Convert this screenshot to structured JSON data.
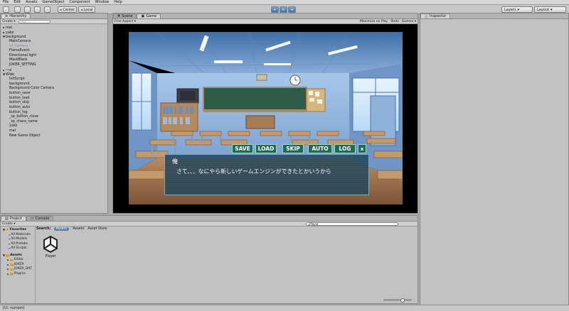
{
  "menu": [
    "File",
    "Edit",
    "Assets",
    "GameObject",
    "Component",
    "Window",
    "Help"
  ],
  "toolbar": {
    "pivot_label": "Center",
    "space_label": "Local",
    "layers_label": "Layers",
    "layout_label": "Layout"
  },
  "hierarchy": {
    "tab": "Hierarchy",
    "create_label": "Create",
    "search_placeholder": "All",
    "items": [
      {
        "label": "mai",
        "arrow": "►",
        "level": 0
      },
      {
        "label": "yako",
        "arrow": "►",
        "level": 0
      },
      {
        "label": "background",
        "arrow": "▼",
        "level": 0
      },
      {
        "label": "MainCamera",
        "arrow": "",
        "level": 1
      },
      {
        "label": "UI_Camera",
        "arrow": "",
        "level": 1
      },
      {
        "label": "FlameEvent",
        "arrow": "",
        "level": 1
      },
      {
        "label": "Directional light",
        "arrow": "",
        "level": 1
      },
      {
        "label": "MaskBlack",
        "arrow": "",
        "level": 1
      },
      {
        "label": "JOKER_SETTING",
        "arrow": "",
        "level": 1
      },
      {
        "label": "~ui",
        "arrow": "►",
        "level": 0
      },
      {
        "label": "Wide",
        "arrow": "▼",
        "level": 0
      },
      {
        "label": "InitScript",
        "arrow": "",
        "level": 1
      },
      {
        "label": "background",
        "arrow": "",
        "level": 1
      },
      {
        "label": "Background Color Camera",
        "arrow": "",
        "level": 1
      },
      {
        "label": "button_save",
        "arrow": "",
        "level": 1
      },
      {
        "label": "button_load",
        "arrow": "",
        "level": 1
      },
      {
        "label": "button_skip",
        "arrow": "",
        "level": 1
      },
      {
        "label": "button_auto",
        "arrow": "",
        "level": 1
      },
      {
        "label": "button_log",
        "arrow": "",
        "level": 1
      },
      {
        "label": "_sp_button_close",
        "arrow": "",
        "level": 1
      },
      {
        "label": "_sp_chara_name",
        "arrow": "",
        "level": 1
      },
      {
        "label": "yako",
        "arrow": "",
        "level": 1
      },
      {
        "label": "mai",
        "arrow": "",
        "level": 1
      },
      {
        "label": "New Game Object",
        "arrow": "",
        "level": 1
      }
    ]
  },
  "tabs": {
    "scene": "Scene",
    "game": "Game",
    "inspector": "Inspector",
    "project": "Project",
    "console": "Console"
  },
  "game": {
    "aspect_label": "Free Aspect",
    "maximize_label": "Maximize on Play",
    "stats_label": "Stats",
    "gizmos_label": "Gizmos",
    "buttons": {
      "save": "SAVE",
      "load": "LOAD",
      "skip": "SKIP",
      "auto": "AUTO",
      "log": "LOG",
      "close": "x"
    },
    "speaker": "俺",
    "dialogue": "さて、、、なにやら新しいゲームエンジンができたとかいうから"
  },
  "project": {
    "create_label": "Create",
    "search_label": "Search:",
    "search_filters": [
      "Assets",
      "'Assets'",
      "Asset Store"
    ],
    "search_value": "Player",
    "favorites_label": "Favorites",
    "favorites": [
      "All Materials",
      "All Models",
      "All Prefabs",
      "All Scripts"
    ],
    "assets_label": "Assets",
    "asset_folders": [
      "Editor",
      "JOKER",
      "JOKER_DAT",
      "Plugins"
    ],
    "result_label": "Player"
  },
  "status": {
    "message": "[UI: numpm]"
  },
  "colors": {
    "ui_button_bg": "#1e6b55",
    "dialog_bg": "#21445a",
    "editor_gray": "#c2c2c2",
    "play_blue": "#3d6fb0"
  }
}
